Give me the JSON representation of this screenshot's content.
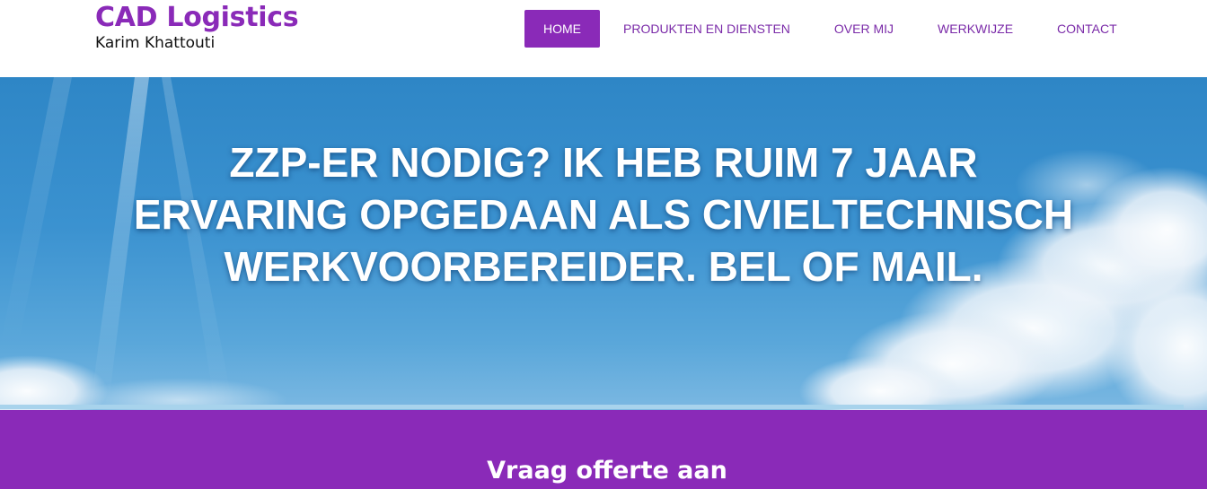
{
  "brand": {
    "title": "CAD Logistics",
    "subtitle": "Karim Khattouti"
  },
  "nav": {
    "items": [
      {
        "label": "HOME",
        "active": true
      },
      {
        "label": "PRODUKTEN EN DIENSTEN",
        "active": false
      },
      {
        "label": "OVER MIJ",
        "active": false
      },
      {
        "label": "WERKWIJZE",
        "active": false
      },
      {
        "label": "CONTACT",
        "active": false
      }
    ]
  },
  "hero": {
    "headline": "ZZP-ER NODIG? IK HEB RUIM 7 JAAR ERVARING OPGEDAAN ALS CIVIELTECHNISCH WERKVOORBEREIDER. BEL OF MAIL.",
    "background": "sky-with-clouds"
  },
  "cta": {
    "title": "Vraag offerte aan"
  },
  "colors": {
    "accent": "#8a2ab8",
    "nav_text": "#7a2aa8",
    "sky": "#3b92d0"
  }
}
